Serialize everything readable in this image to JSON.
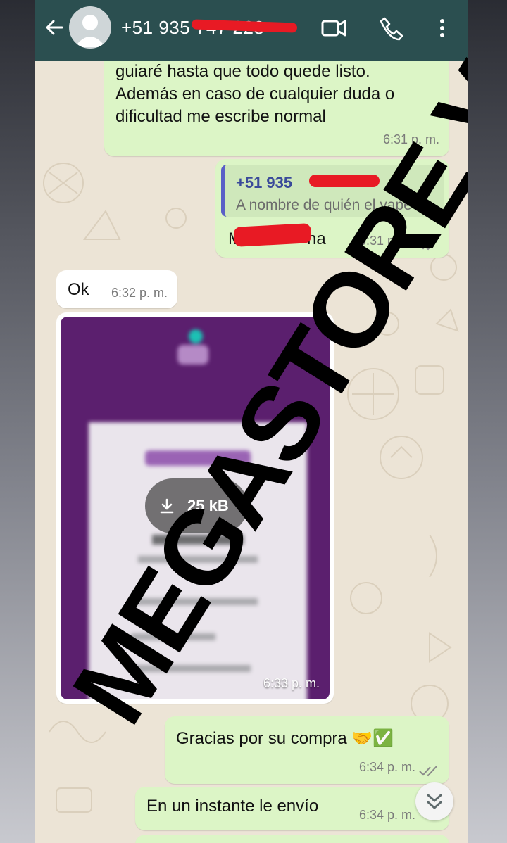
{
  "header": {
    "contact_name": "+51 935 747 228",
    "back_icon": "arrow-left-icon",
    "video_icon": "video-call-icon",
    "call_icon": "phone-icon",
    "menu_icon": "more-vert-icon",
    "color": "#2b4f50"
  },
  "messages": [
    {
      "direction": "out",
      "lines": [
        "guiaré hasta que todo quede listo.",
        "Además en caso de cualquier duda o",
        "dificultad me escribe normal"
      ],
      "time": "6:31 p. m."
    },
    {
      "direction": "out",
      "quote_phone": "+51 935",
      "quote_caption": "A nombre de quién el yape",
      "text": "M",
      "text_tail": "na",
      "time": "6:31 p. m.",
      "status": "read"
    },
    {
      "direction": "in",
      "text": "Ok",
      "time": "6:32 p. m."
    },
    {
      "direction": "in",
      "type": "image",
      "download_size": "25 kB",
      "time": "6:33 p. m."
    },
    {
      "direction": "out",
      "text": "Gracias por su compra 🤝✅",
      "time": "6:34 p. m.",
      "status": "read"
    },
    {
      "direction": "out",
      "text": "En un instante le envío",
      "time": "6:34 p. m."
    }
  ],
  "watermark": "MEGASTORE VIP",
  "colors": {
    "outgoing_bubble": "#dcf5c6",
    "incoming_bubble": "#ffffff",
    "read_ticks": "#8a8a8a",
    "redaction": "#e81a24"
  }
}
